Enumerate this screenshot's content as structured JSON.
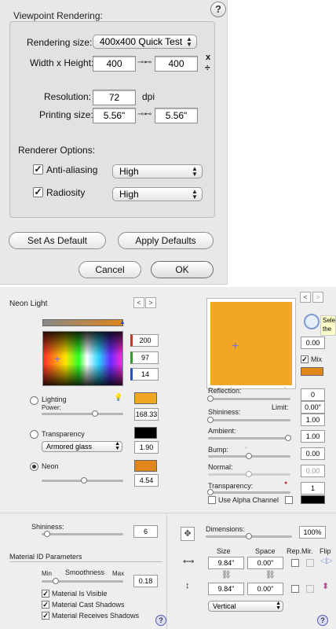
{
  "dialog": {
    "title": "Viewpoint Rendering:",
    "rendering_size_label": "Rendering size:",
    "rendering_size_value": "400x400 Quick Test",
    "width_height_label": "Width x Height:",
    "width_value": "400",
    "height_value": "400",
    "swap_symbol": "x",
    "divide_symbol": "÷",
    "resolution_label": "Resolution:",
    "resolution_value": "72",
    "resolution_unit": "dpi",
    "printing_size_label": "Printing size:",
    "print_width": "5.56\"",
    "print_height": "5.56\"",
    "renderer_options_label": "Renderer Options:",
    "antialiasing_label": "Anti-aliasing",
    "antialiasing_checked": true,
    "antialiasing_value": "High",
    "radiosity_label": "Radiosity",
    "radiosity_checked": true,
    "radiosity_value": "High",
    "set_default_label": "Set As Default",
    "apply_defaults_label": "Apply Defaults",
    "cancel_label": "Cancel",
    "ok_label": "OK",
    "help_label": "?"
  },
  "material": {
    "name": "Neon Light",
    "nav_prev": "<",
    "nav_next": ">",
    "rgb": {
      "r": "200",
      "g": "97",
      "b": "14"
    },
    "lighting_label": "Lighting",
    "power_label": "Power:",
    "power_value": "168.33",
    "transparency_label": "Transparency",
    "transparency_type": "Armored glass",
    "transparency_value": "1.90",
    "neon_label": "Neon",
    "neon_value": "4.54",
    "shininess_label": "Shininess:",
    "shininess_value": "6",
    "id_params_label": "Material ID Parameters",
    "min_label": "Min",
    "smoothness_label": "Smoothness",
    "max_label": "Max",
    "smoothness_value": "0.18",
    "visible_label": "Material Is Visible",
    "cast_label": "Material Cast Shadows",
    "receive_label": "Material Receives Shadows",
    "help_label": "?"
  },
  "preview": {
    "color": "#f0a724",
    "reflection_label": "Reflection:",
    "reflection_value": "0",
    "limit_label": "Limit:",
    "limit_value": "0.00\"",
    "shininess_label": "Shininess:",
    "shininess_value": "1.00",
    "ambient_label": "Ambient:",
    "ambient_value": "1.00",
    "bump_label": "Bump:",
    "bump_value": "0.00",
    "normal_label": "Normal:",
    "normal_value": "0.00",
    "transparency_label": "Transparency:",
    "transparency_value": "1",
    "alpha_label": "Use Alpha Channel",
    "right_value": "0.00",
    "mix_label": "Mix",
    "tooltip_line1": "Selec",
    "tooltip_line2": "the s",
    "nav_prev": "<",
    "nav_next": ">"
  },
  "texture": {
    "dimensions_label": "Dimensions:",
    "dimensions_value": "100%",
    "size_label": "Size",
    "space_label": "Space",
    "rep_label": "Rep.",
    "mir_label": "Mir.",
    "flip_label": "Flip",
    "width_size": "9.84\"",
    "width_space": "0.00\"",
    "height_size": "9.84\"",
    "height_space": "0.00\"",
    "orientation": "Vertical",
    "help_label": "?"
  },
  "colors": {
    "accent_orange": "#f0a724",
    "swatch_orange": "#e0861a",
    "red": "#c0392b",
    "green": "#2e9b2e",
    "blue": "#2a4fbf"
  }
}
